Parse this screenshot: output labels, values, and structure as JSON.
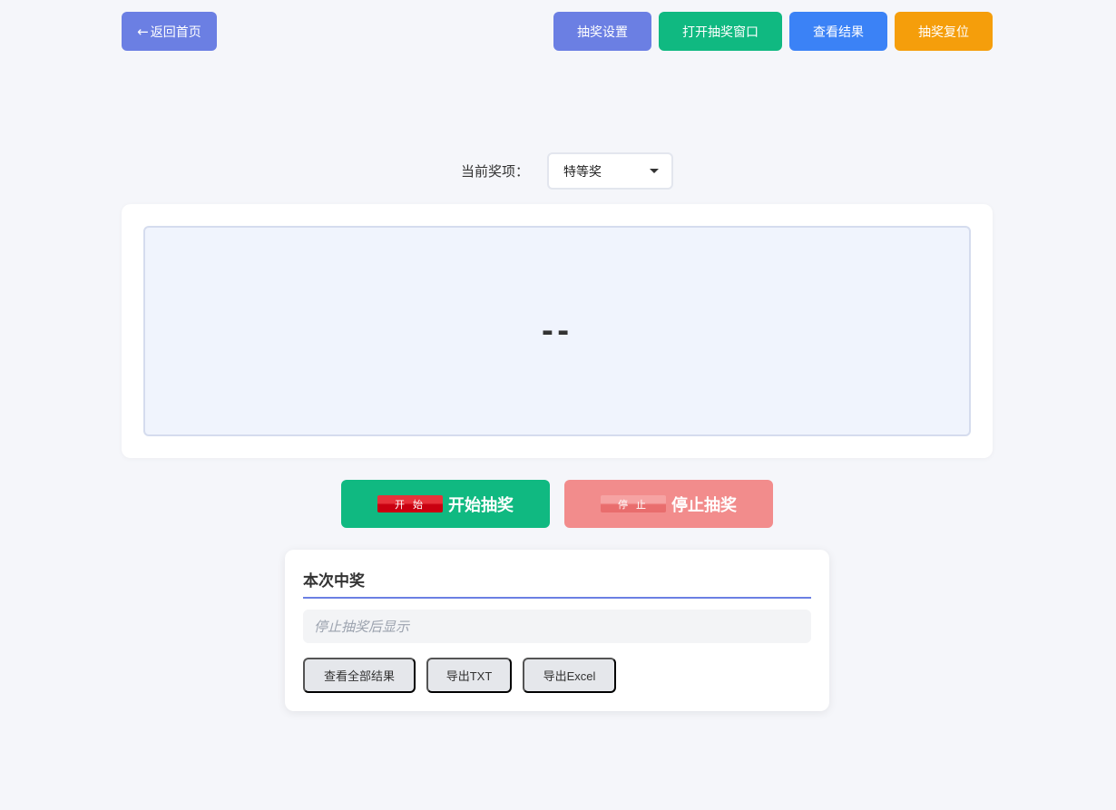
{
  "header": {
    "back_arrow": "←",
    "back_label": "返回首页",
    "settings_label": "抽奖设置",
    "open_window_label": "打开抽奖窗口",
    "view_results_label": "查看结果",
    "reset_label": "抽奖复位"
  },
  "prize": {
    "label": "当前奖项：",
    "selected": "特等奖"
  },
  "display": {
    "value": "--"
  },
  "controls": {
    "start_tag": "开 始",
    "start_label": "开始抽奖",
    "stop_tag": "停 止",
    "stop_label": "停止抽奖"
  },
  "result_panel": {
    "title": "本次中奖",
    "placeholder": "停止抽奖后显示",
    "view_all_label": "查看全部结果",
    "export_txt_label": "导出TXT",
    "export_excel_label": "导出Excel"
  },
  "colors": {
    "primary": "#6b7fe3",
    "green": "#10b981",
    "blue": "#3b82f6",
    "orange": "#f59e0b",
    "stop_red": "#f28c8c"
  }
}
